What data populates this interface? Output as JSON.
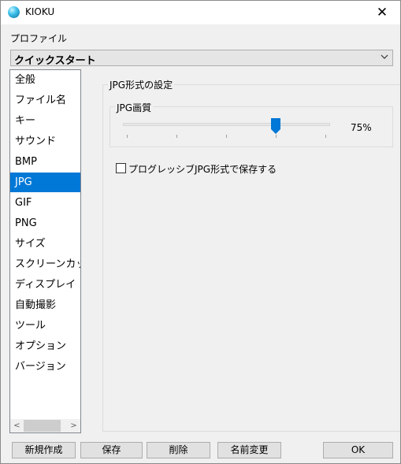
{
  "window": {
    "title": "KIOKU",
    "close_glyph": "✕",
    "icon": "kioku-app-icon"
  },
  "profile": {
    "label": "プロファイル",
    "selected": "クイックスタート"
  },
  "nav": {
    "selected_index": 5,
    "items": [
      {
        "label": "全般"
      },
      {
        "label": "ファイル名"
      },
      {
        "label": "キー"
      },
      {
        "label": "サウンド"
      },
      {
        "label": "BMP"
      },
      {
        "label": "JPG"
      },
      {
        "label": "GIF"
      },
      {
        "label": "PNG"
      },
      {
        "label": "サイズ"
      },
      {
        "label": "スクリーンカッ"
      },
      {
        "label": "ディスプレイ"
      },
      {
        "label": "自動撮影"
      },
      {
        "label": "ツール"
      },
      {
        "label": "オプション"
      },
      {
        "label": "バージョン"
      }
    ],
    "scroll_left_glyph": "<",
    "scroll_right_glyph": ">"
  },
  "settings": {
    "group_title": "JPG形式の設定",
    "quality": {
      "title": "JPG画質",
      "value": 0.75,
      "display": "75%"
    },
    "progressive": {
      "label": "プログレッシブJPG形式で保存する",
      "checked": false
    }
  },
  "buttons": {
    "new": "新規作成",
    "save": "保存",
    "delete": "削除",
    "rename": "名前変更",
    "ok": "OK"
  },
  "colors": {
    "selection": "#0078d7",
    "slider_thumb": "#0078d7"
  }
}
